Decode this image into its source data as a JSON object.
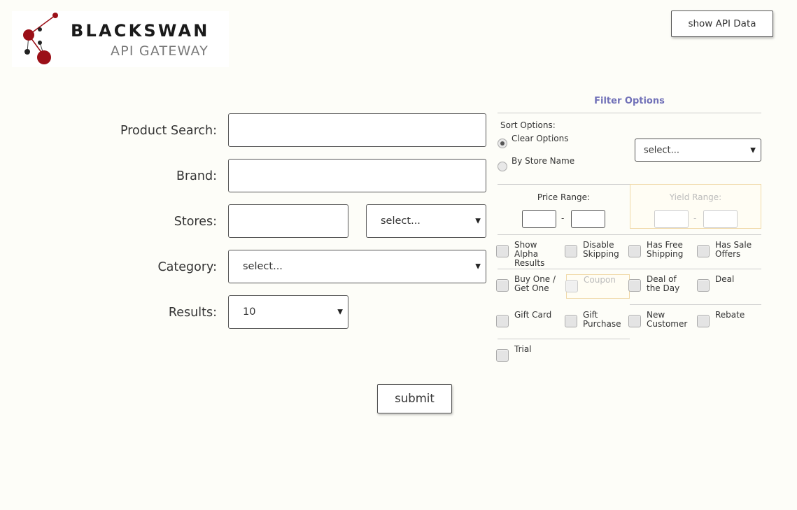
{
  "logo": {
    "line1": "BLACKSWAN",
    "line2": "API GATEWAY",
    "accent": "#9b0f17"
  },
  "header": {
    "api_button": "show API Data"
  },
  "form": {
    "product_search": {
      "label": "Product Search:",
      "value": ""
    },
    "brand": {
      "label": "Brand:",
      "value": ""
    },
    "stores": {
      "label": "Stores:",
      "value": "",
      "select": "select..."
    },
    "category": {
      "label": "Category:",
      "select": "select..."
    },
    "results": {
      "label": "Results:",
      "select": "10"
    },
    "submit": "submit"
  },
  "filters": {
    "title": "Filter Options",
    "sort": {
      "label": "Sort Options:",
      "options": [
        "Clear Options",
        "By Store Name"
      ],
      "selected": "Clear Options",
      "select": "select..."
    },
    "price_range": {
      "label": "Price Range:",
      "min": "",
      "max": "",
      "dash": "-"
    },
    "yield_range": {
      "label": "Yield Range:",
      "min": "",
      "max": "",
      "dash": "-"
    },
    "checkboxes": [
      [
        "Show",
        "Alpha",
        "Results"
      ],
      [
        "Disable",
        "Skipping"
      ],
      [
        "Has Free",
        "Shipping"
      ],
      [
        "Has Sale",
        "Offers"
      ],
      [
        "Buy One /",
        "Get One"
      ],
      [
        "Coupon"
      ],
      [
        "Deal of",
        "the Day"
      ],
      [
        "Deal"
      ],
      [
        "Gift Card"
      ],
      [
        "Gift",
        "Purchase"
      ],
      [
        "New",
        "Customer"
      ],
      [
        "Rebate"
      ],
      [
        "Trial"
      ]
    ]
  }
}
